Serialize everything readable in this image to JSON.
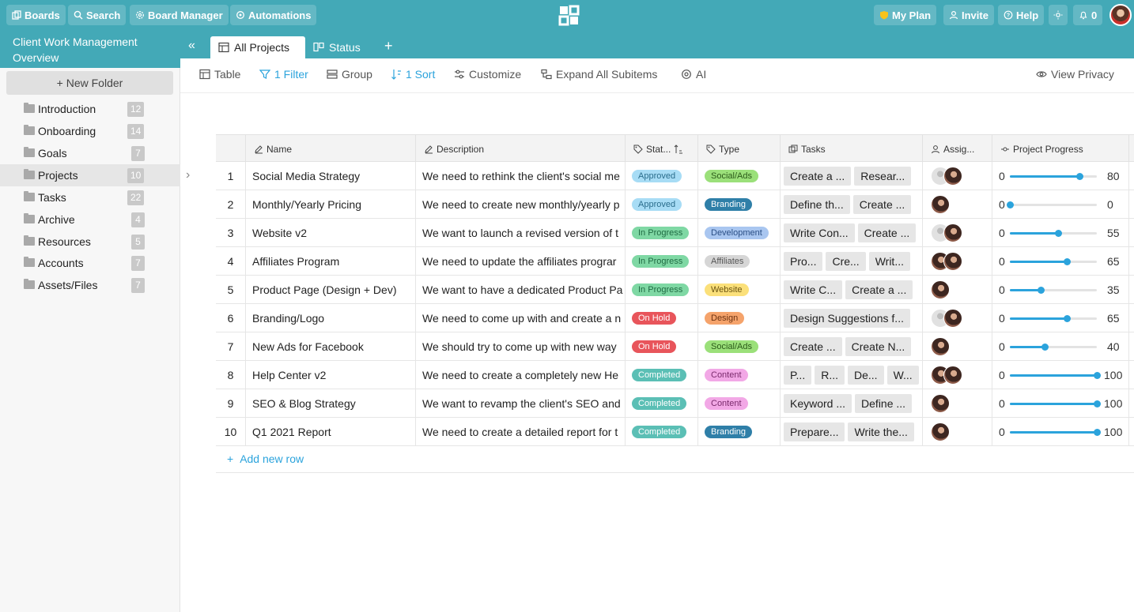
{
  "topbar": {
    "boards": "Boards",
    "search": "Search",
    "board_manager": "Board Manager",
    "automations": "Automations",
    "my_plan": "My Plan",
    "invite": "Invite",
    "help": "Help",
    "notifications": "0"
  },
  "sidebar": {
    "workspace_title": "Client Work Management Overview",
    "new_folder": "+ New Folder",
    "folders": [
      {
        "label": "Introduction",
        "count": "12"
      },
      {
        "label": "Onboarding",
        "count": "14"
      },
      {
        "label": "Goals",
        "count": "7"
      },
      {
        "label": "Projects",
        "count": "10"
      },
      {
        "label": "Tasks",
        "count": "22"
      },
      {
        "label": "Archive",
        "count": "4"
      },
      {
        "label": "Resources",
        "count": "5"
      },
      {
        "label": "Accounts",
        "count": "7"
      },
      {
        "label": "Assets/Files",
        "count": "7"
      }
    ]
  },
  "tabs": [
    {
      "label": "All Projects"
    },
    {
      "label": "Status"
    }
  ],
  "toolbar": {
    "table": "Table",
    "filter": "1 Filter",
    "group": "Group",
    "sort": "1 Sort",
    "customize": "Customize",
    "expand": "Expand All Subitems",
    "ai": "AI",
    "privacy": "View Privacy"
  },
  "columns": {
    "name": "Name",
    "description": "Description",
    "status": "Stat...",
    "type": "Type",
    "tasks": "Tasks",
    "assignee": "Assig...",
    "progress": "Project Progress"
  },
  "colors": {
    "accent": "#43a9b7",
    "link": "#2ba3dc"
  },
  "rows": [
    {
      "num": "1",
      "name": "Social Media Strategy",
      "description": "We need to rethink the client's social me",
      "status": "Approved",
      "type": "Social/Ads",
      "tasks": [
        "Create a ...",
        "Resear..."
      ],
      "assignees": [
        "grey",
        "person"
      ],
      "min": "0",
      "max": "80",
      "progress": 80
    },
    {
      "num": "2",
      "name": "Monthly/Yearly Pricing",
      "description": "We need to create new monthly/yearly p",
      "status": "Approved",
      "type": "Branding",
      "tasks": [
        "Define th...",
        "Create ..."
      ],
      "assignees": [
        "person"
      ],
      "min": "0",
      "max": "0",
      "progress": 0
    },
    {
      "num": "3",
      "name": "Website v2",
      "description": "We want to launch a revised version of t",
      "status": "In Progress",
      "type": "Development",
      "tasks": [
        "Write Con...",
        "Create ..."
      ],
      "assignees": [
        "grey",
        "person"
      ],
      "min": "0",
      "max": "55",
      "progress": 55
    },
    {
      "num": "4",
      "name": "Affiliates Program",
      "description": "We need to update the affiliates prograr",
      "status": "In Progress",
      "type": "Affiliates",
      "tasks": [
        "Pro...",
        "Cre...",
        "Writ..."
      ],
      "assignees": [
        "person",
        "person"
      ],
      "min": "0",
      "max": "65",
      "progress": 65
    },
    {
      "num": "5",
      "name": "Product Page (Design + Dev)",
      "description": "We want to have a dedicated Product Pa",
      "status": "In Progress",
      "type": "Website",
      "tasks": [
        "Write C...",
        "Create a ..."
      ],
      "assignees": [
        "person"
      ],
      "min": "0",
      "max": "35",
      "progress": 35
    },
    {
      "num": "6",
      "name": "Branding/Logo",
      "description": "We need to come up with and create a n",
      "status": "On Hold",
      "type": "Design",
      "tasks": [
        "Design Suggestions f..."
      ],
      "assignees": [
        "grey",
        "person"
      ],
      "min": "0",
      "max": "65",
      "progress": 65
    },
    {
      "num": "7",
      "name": "New Ads for Facebook",
      "description": "We should try to come up with new way",
      "status": "On Hold",
      "type": "Social/Ads",
      "tasks": [
        "Create ...",
        "Create N..."
      ],
      "assignees": [
        "person"
      ],
      "min": "0",
      "max": "40",
      "progress": 40
    },
    {
      "num": "8",
      "name": "Help Center v2",
      "description": "We need to create a completely new He",
      "status": "Completed",
      "type": "Content",
      "tasks": [
        "P...",
        "R...",
        "De...",
        "W..."
      ],
      "assignees": [
        "person",
        "person"
      ],
      "min": "0",
      "max": "100",
      "progress": 100
    },
    {
      "num": "9",
      "name": "SEO & Blog Strategy",
      "description": "We want to revamp the client's SEO and",
      "status": "Completed",
      "type": "Content",
      "tasks": [
        "Keyword ...",
        "Define ..."
      ],
      "assignees": [
        "person"
      ],
      "min": "0",
      "max": "100",
      "progress": 100
    },
    {
      "num": "10",
      "name": "Q1 2021 Report",
      "description": "We need to create a detailed report for t",
      "status": "Completed",
      "type": "Branding",
      "tasks": [
        "Prepare...",
        "Write the..."
      ],
      "assignees": [
        "person"
      ],
      "min": "0",
      "max": "100",
      "progress": 100
    }
  ],
  "add_row": "Add new row",
  "status_colors": {
    "Approved": {
      "bg": "#a7dcf5",
      "fg": "#2a6d8c"
    },
    "In Progress": {
      "bg": "#7fd8a4",
      "fg": "#1f6b43"
    },
    "On Hold": {
      "bg": "#e8555b",
      "fg": "#ffffff"
    },
    "Completed": {
      "bg": "#5bbfb5",
      "fg": "#ffffff"
    }
  },
  "type_colors": {
    "Social/Ads": {
      "bg": "#9be07a",
      "fg": "#2b5a19"
    },
    "Branding": {
      "bg": "#2f7fa8",
      "fg": "#ffffff"
    },
    "Development": {
      "bg": "#a9c6f0",
      "fg": "#2b4f85"
    },
    "Affiliates": {
      "bg": "#d6d6d6",
      "fg": "#555555"
    },
    "Website": {
      "bg": "#fbe07a",
      "fg": "#6b5410"
    },
    "Design": {
      "bg": "#f5a36b",
      "fg": "#6b3110"
    },
    "Content": {
      "bg": "#f2a8e6",
      "fg": "#7a2a6c"
    }
  }
}
